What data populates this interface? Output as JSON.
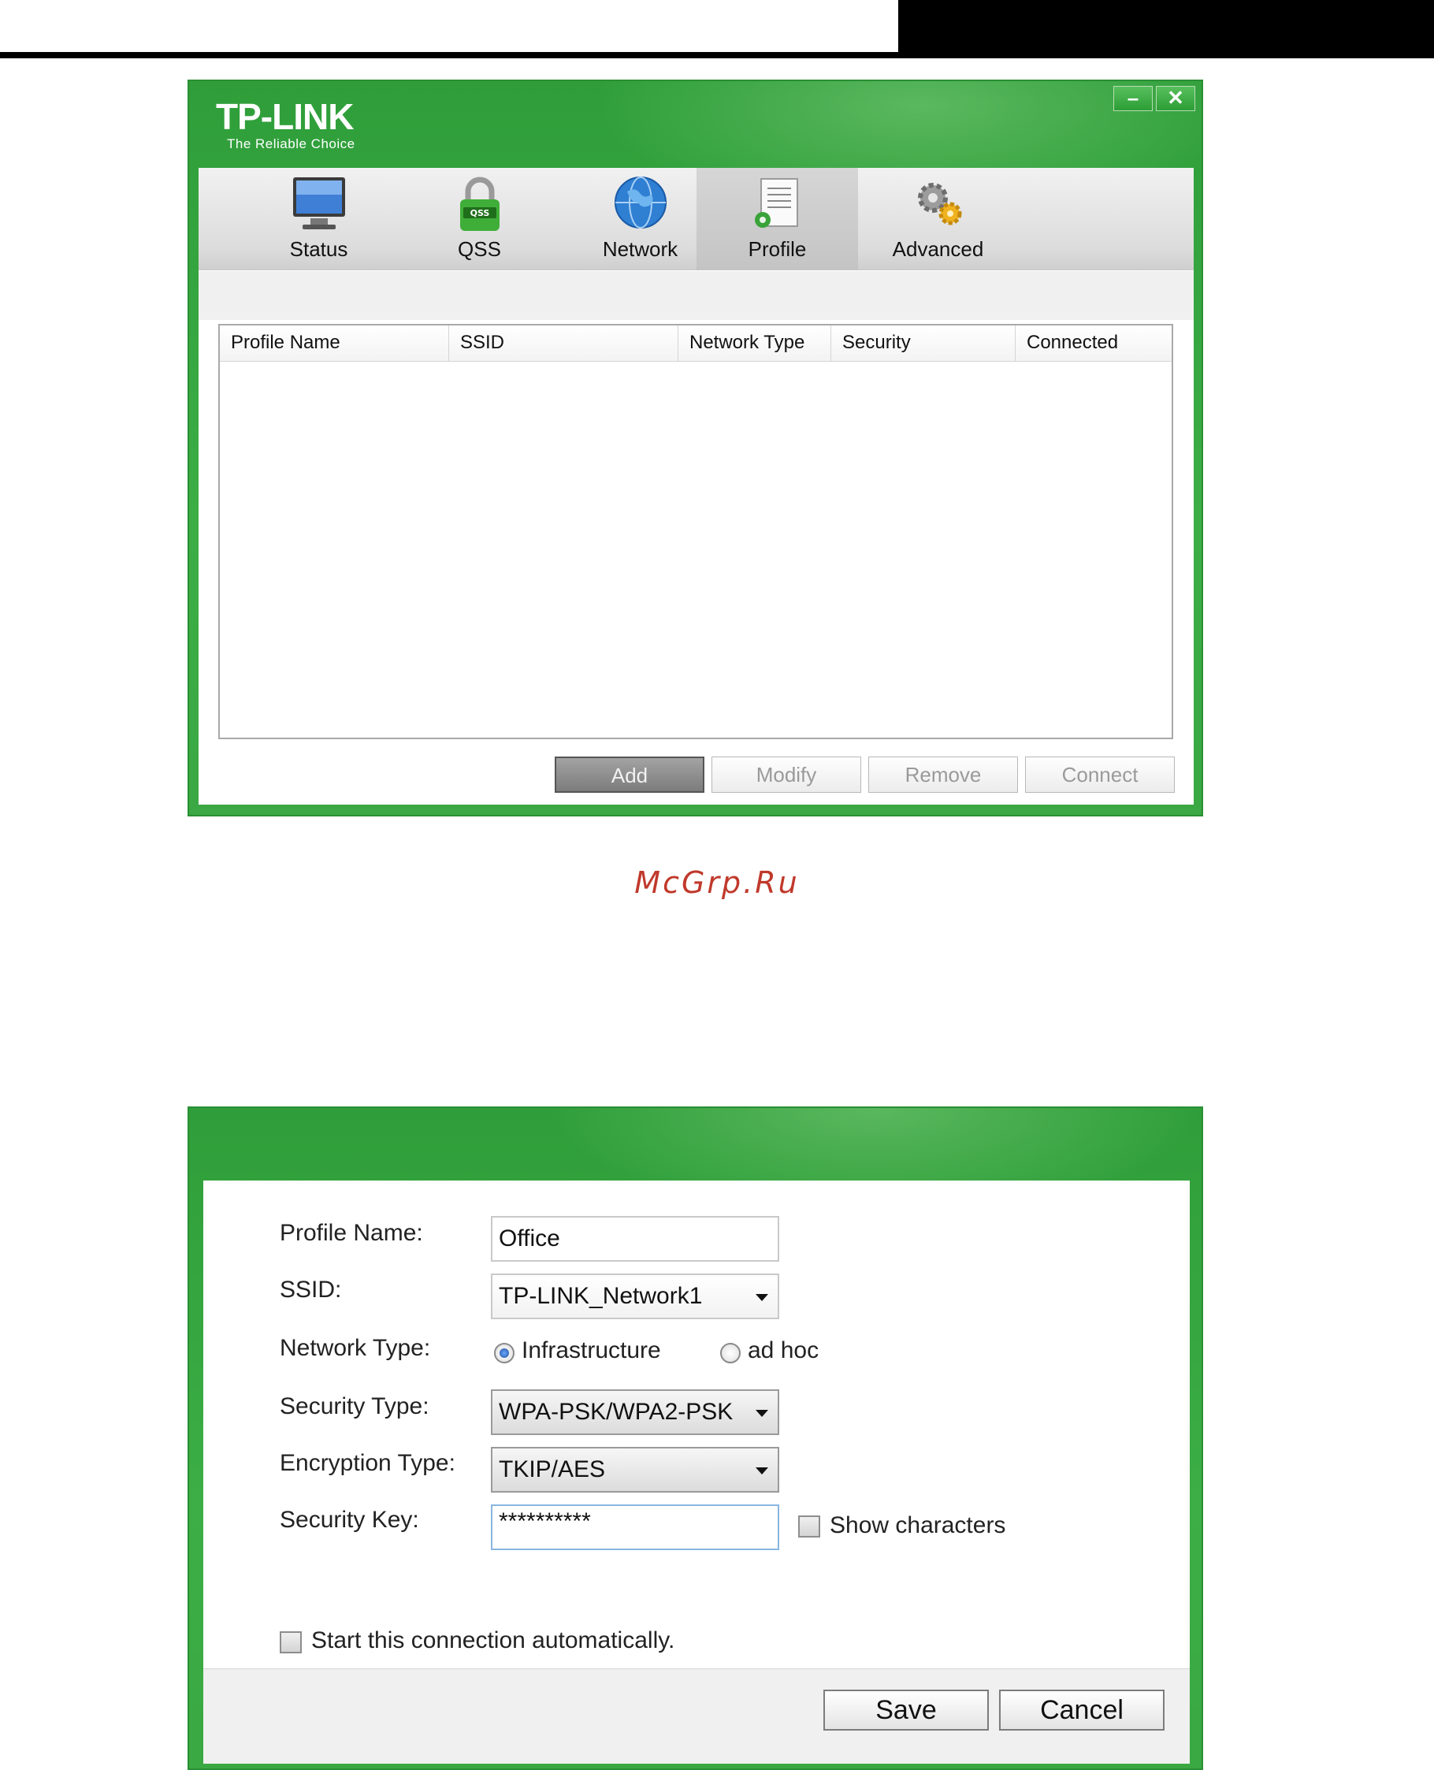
{
  "profile_window": {
    "logo": {
      "brand": "TP-LINK",
      "tagline": "The Reliable Choice"
    },
    "window_controls": {
      "minimize": "–",
      "close": "✕"
    },
    "tabs": [
      {
        "label": "Status",
        "icon": "monitor-icon"
      },
      {
        "label": "QSS",
        "icon": "qss-lock-icon"
      },
      {
        "label": "Network",
        "icon": "globe-icon"
      },
      {
        "label": "Profile",
        "icon": "profile-document-icon",
        "active": true
      },
      {
        "label": "Advanced",
        "icon": "gears-icon"
      }
    ],
    "table": {
      "columns": [
        "Profile Name",
        "SSID",
        "Network Type",
        "Security",
        "Connected"
      ],
      "rows": []
    },
    "buttons": {
      "add": "Add",
      "modify": "Modify",
      "remove": "Remove",
      "connect": "Connect"
    }
  },
  "watermark": "McGrp.Ru",
  "profile_dialog": {
    "labels": {
      "profile_name": "Profile Name:",
      "ssid": "SSID:",
      "network_type": "Network Type:",
      "security_type": "Security Type:",
      "encryption_type": "Encryption Type:",
      "security_key": "Security Key:"
    },
    "values": {
      "profile_name": "Office",
      "ssid": "TP-LINK_Network1",
      "security_type": "WPA-PSK/WPA2-PSK",
      "encryption_type": "TKIP/AES",
      "security_key": "**********"
    },
    "network_type_options": {
      "infrastructure": "Infrastructure",
      "adhoc": "ad hoc",
      "selected": "infrastructure"
    },
    "show_characters": "Show characters",
    "auto_start": "Start this connection automatically.",
    "buttons": {
      "save": "Save",
      "cancel": "Cancel"
    }
  },
  "colors": {
    "window_green": "#3aa843",
    "add_button": "#8c8c8c",
    "radio_selected": "#2a5fb0"
  }
}
